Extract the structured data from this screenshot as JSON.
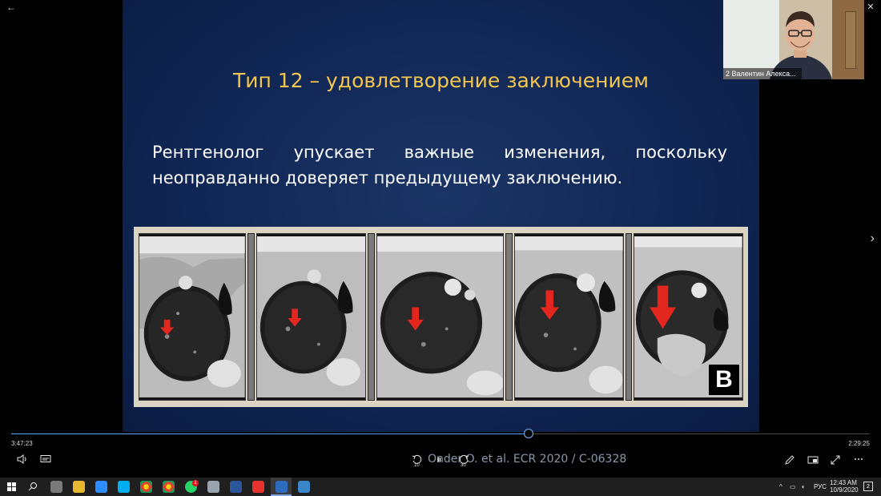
{
  "window": {
    "back_glyph": "←",
    "minimize_glyph": "—",
    "restore_glyph": "❐",
    "close_glyph": "✕"
  },
  "slide": {
    "title": "Тип 12 – удовлетворение заключением",
    "body": "Рентгенолог упускает важные изменения, поскольку неоправданно доверяет предыдущему заключению.",
    "panel_label": "B",
    "citation": "Onder O. et al. ECR 2020 / C-06328",
    "title_color": "#f3c64d",
    "background_color": "#122a5a",
    "arrow_color": "#e3261e"
  },
  "video_tile": {
    "participant_name": "2 Валентин Алекса..."
  },
  "player": {
    "time_elapsed": "3:47:23",
    "time_total": "2:29:25",
    "progress": 0.603,
    "skip_back_label": "10",
    "skip_forward_label": "30",
    "pause_glyph": "⏸",
    "volume_icon": "speaker-icon",
    "captions_icon": "captions-icon",
    "next_glyph": "›"
  },
  "taskbar": {
    "language": "РУС",
    "time": "12:43 AM",
    "date": "10/9/2020",
    "notification_count": "2",
    "badge_count": "1"
  }
}
